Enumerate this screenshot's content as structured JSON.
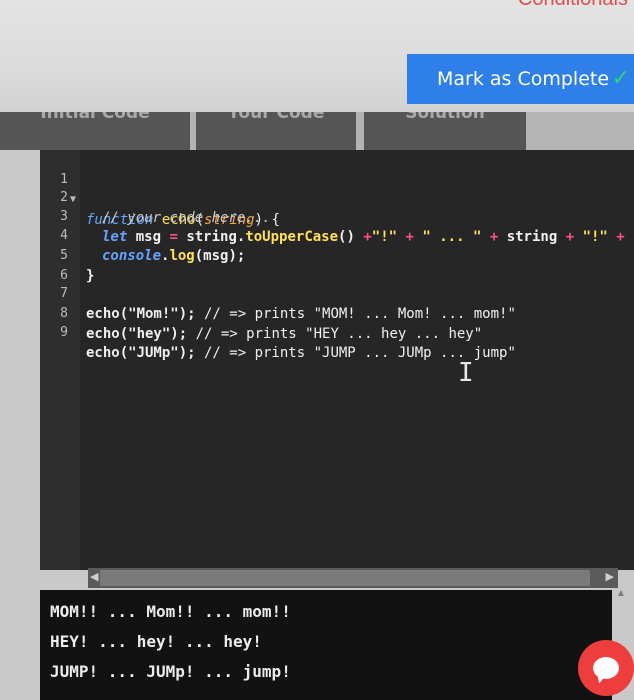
{
  "header": {
    "nav_link": "Conditionals",
    "complete_button": "Mark as Complete",
    "complete_icon": "check-icon"
  },
  "tabs": [
    {
      "label": "Initial Code"
    },
    {
      "label": "Your Code"
    },
    {
      "label": "Solution"
    }
  ],
  "editor": {
    "line_numbers": [
      "1",
      "2",
      "3",
      "4",
      "5",
      "6",
      "7",
      "8",
      "9"
    ],
    "lines": {
      "l1": {
        "kw": "function",
        "fn": "echo",
        "p1": "(",
        "param": "string",
        "p2": ") {"
      },
      "l2": {
        "comment": "// your code here..."
      },
      "l3": {
        "kw": "let",
        "t1": " msg ",
        "op1": "=",
        "t2": " string.",
        "fn": "toUpperCase",
        "t3": "() ",
        "op2": "+",
        "s1": "\"!\"",
        "op3": " + ",
        "s2": "\" ... \"",
        "op4": " + ",
        "t4": "string ",
        "op5": "+",
        "s3": " \"!\"",
        "op6": " + ",
        "s4": "\""
      },
      "l4": {
        "kw": "console",
        "t1": ".",
        "fn": "log",
        "t2": "(msg);"
      },
      "l5": {
        "t1": "}"
      },
      "l7": {
        "call": "echo(\"Mom!\");",
        "comment": " // => prints \"MOM! ... Mom! ... mom!\""
      },
      "l8": {
        "call": "echo(\"hey\");",
        "comment": " // => prints \"HEY ... hey ... hey\""
      },
      "l9": {
        "call": "echo(\"JUMp\");",
        "comment": " // => prints \"JUMP ... JUMp ... jump\""
      }
    },
    "cursor_icon": "text-cursor-icon"
  },
  "console": {
    "lines": [
      "MOM!! ... Mom!! ... mom!!",
      "HEY! ... hey! ... hey!",
      "JUMP! ... JUMp! ... jump!"
    ]
  },
  "chat": {
    "icon": "chat-bubble-icon"
  },
  "colors": {
    "accent": "#2e7fe8",
    "chat": "#ee3d3d",
    "success": "#2fd67b"
  }
}
